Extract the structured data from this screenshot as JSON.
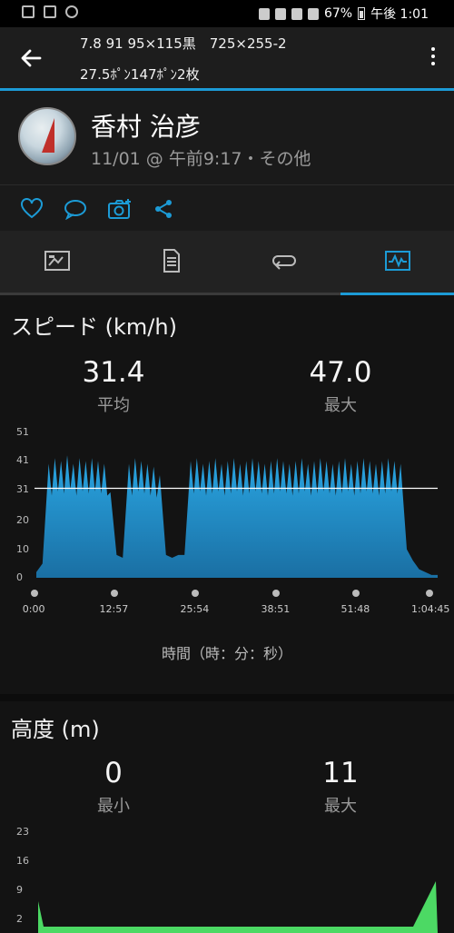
{
  "statusbar": {
    "battery": "67%",
    "time": "午後 1:01"
  },
  "appbar": {
    "title_line1": "7.8 91 95×115黒　725×255-2",
    "title_line2": "27.5ﾎﾟﾝ147ﾎﾟﾝ2枚"
  },
  "profile": {
    "name": "香村 治彦",
    "meta": "11/01 @ 午前9:17・その他"
  },
  "speed": {
    "title": "スピード (km/h)",
    "avg_value": "31.4",
    "avg_label": "平均",
    "max_value": "47.0",
    "max_label": "最大"
  },
  "altitude": {
    "title": "高度 (m)",
    "min_value": "0",
    "min_label": "最小",
    "max_value": "11",
    "max_label": "最大"
  },
  "chart_data": [
    {
      "type": "area",
      "title": "スピード (km/h)",
      "xlabel": "時間（時：分：秒）",
      "x_ticks": [
        "0:00",
        "12:57",
        "25:54",
        "38:51",
        "51:48",
        "1:04:45"
      ],
      "y_ticks": [
        "0",
        "10",
        "20",
        "31",
        "41",
        "51"
      ],
      "ylim": [
        0,
        51
      ],
      "average_line": 31.4,
      "x_minutes": [
        0,
        1,
        2,
        3,
        4,
        5,
        6,
        7,
        8,
        9,
        10,
        11,
        12,
        13,
        14,
        15,
        16,
        17,
        18,
        19,
        20,
        21,
        22,
        23,
        24,
        25,
        26,
        27,
        28,
        29,
        30,
        31,
        32,
        33,
        34,
        35,
        36,
        37,
        38,
        39,
        40,
        41,
        42,
        43,
        44,
        45,
        46,
        47,
        48,
        49,
        50,
        51,
        52,
        53,
        54,
        55,
        56,
        57,
        58,
        59,
        60,
        61,
        62,
        63,
        64,
        65
      ],
      "values": [
        2,
        5,
        40,
        42,
        41,
        43,
        40,
        42,
        41,
        42,
        41,
        40,
        30,
        8,
        7,
        40,
        42,
        41,
        40,
        39,
        36,
        8,
        7,
        8,
        8,
        41,
        42,
        40,
        41,
        42,
        40,
        41,
        42,
        40,
        41,
        42,
        41,
        40,
        41,
        42,
        41,
        40,
        41,
        42,
        40,
        41,
        42,
        41,
        40,
        41,
        42,
        40,
        41,
        42,
        41,
        40,
        41,
        42,
        41,
        40,
        10,
        6,
        3,
        2,
        1,
        1
      ],
      "color": "#2aa0dc"
    },
    {
      "type": "area",
      "title": "高度 (m)",
      "y_ticks": [
        "2",
        "9",
        "16",
        "23"
      ],
      "color": "#4cd964"
    }
  ]
}
